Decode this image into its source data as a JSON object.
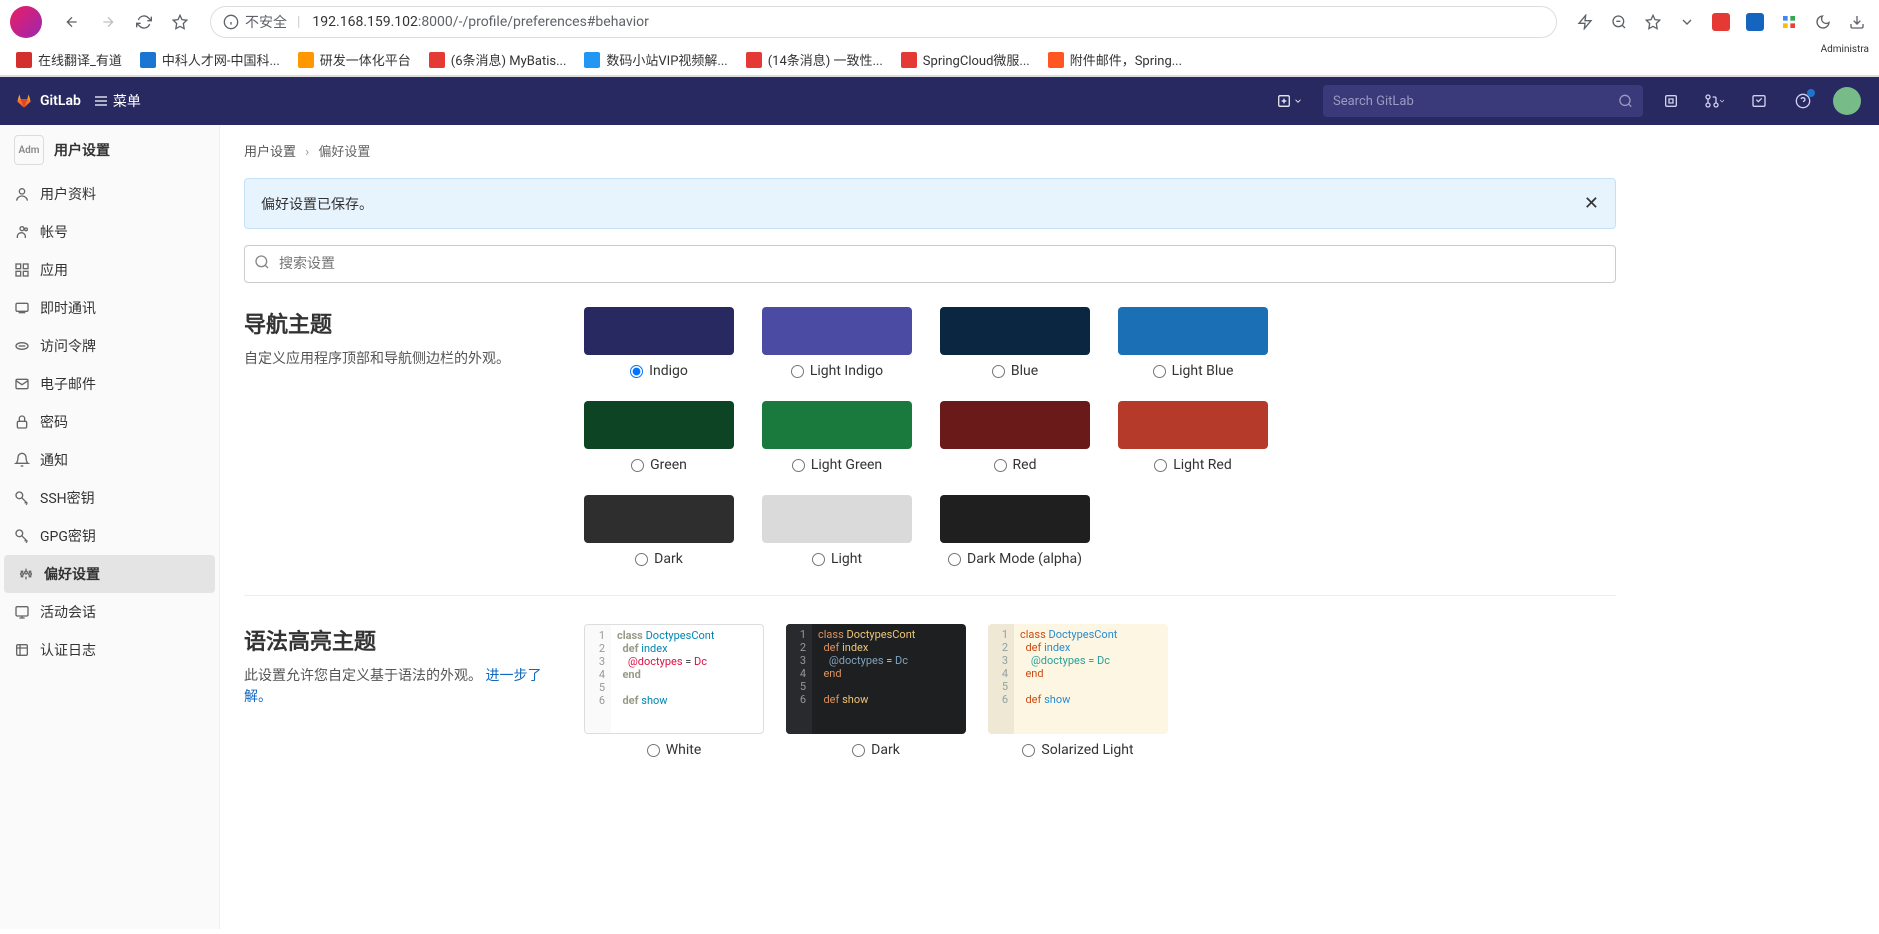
{
  "browser": {
    "security_text": "不安全",
    "url_host": "192.168.159.102",
    "url_port": ":8000",
    "url_path": "/-/profile/preferences#behavior"
  },
  "bookmarks": [
    {
      "label": "在线翻译_有道",
      "color": "#d32f2f"
    },
    {
      "label": "中科人才网-中国科...",
      "color": "#1976d2"
    },
    {
      "label": "研发一体化平台",
      "color": "#ff9800"
    },
    {
      "label": "(6条消息) MyBatis...",
      "color": "#e53935"
    },
    {
      "label": "数码小站VIP视频解...",
      "color": "#2196f3"
    },
    {
      "label": "(14条消息) 一致性...",
      "color": "#e53935"
    },
    {
      "label": "SpringCloud微服...",
      "color": "#e53935"
    },
    {
      "label": "附件邮件，Spring...",
      "color": "#ff5722"
    }
  ],
  "header": {
    "brand": "GitLab",
    "menu": "菜单",
    "search_placeholder": "Search GitLab",
    "admin_label": "Administra"
  },
  "sidebar": {
    "title": "用户设置",
    "avatar_alt": "Adm",
    "items": [
      {
        "label": "用户资料"
      },
      {
        "label": "帐号"
      },
      {
        "label": "应用"
      },
      {
        "label": "即时通讯"
      },
      {
        "label": "访问令牌"
      },
      {
        "label": "电子邮件"
      },
      {
        "label": "密码"
      },
      {
        "label": "通知"
      },
      {
        "label": "SSH密钥"
      },
      {
        "label": "GPG密钥"
      },
      {
        "label": "偏好设置"
      },
      {
        "label": "活动会话"
      },
      {
        "label": "认证日志"
      }
    ],
    "active_index": 10
  },
  "breadcrumb": {
    "root": "用户设置",
    "current": "偏好设置"
  },
  "alert": {
    "text": "偏好设置已保存。"
  },
  "search": {
    "placeholder": "搜索设置"
  },
  "nav_theme": {
    "title": "导航主题",
    "desc": "自定义应用程序顶部和导航侧边栏的外观。",
    "selected": "Indigo",
    "options": [
      {
        "label": "Indigo",
        "color": "#292961"
      },
      {
        "label": "Light Indigo",
        "color": "#4b4ba3"
      },
      {
        "label": "Blue",
        "color": "#0b2640"
      },
      {
        "label": "Light Blue",
        "color": "#1a6fb5"
      },
      {
        "label": "Green",
        "color": "#0d4524"
      },
      {
        "label": "Light Green",
        "color": "#1a7a3d"
      },
      {
        "label": "Red",
        "color": "#6b1a1a"
      },
      {
        "label": "Light Red",
        "color": "#b53a2a"
      },
      {
        "label": "Dark",
        "color": "#2e2e2e"
      },
      {
        "label": "Light",
        "color": "#dadada"
      },
      {
        "label": "Dark Mode (alpha)",
        "color": "#1f1f1f"
      }
    ]
  },
  "syntax_theme": {
    "title": "语法高亮主题",
    "desc_prefix": "此设置允许您自定义基于语法的外观。",
    "link": "进一步了解。",
    "options": [
      "White",
      "Dark",
      "Solarized Light"
    ],
    "code_lines": [
      "class DoctypesCont",
      "  def index",
      "    @doctypes = Dc",
      "  end",
      "",
      "  def show"
    ]
  }
}
